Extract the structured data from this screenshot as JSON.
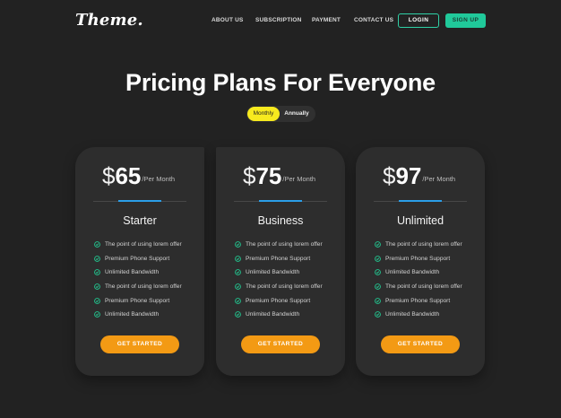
{
  "brand": {
    "logo_text": "Theme."
  },
  "nav": {
    "links": [
      "ABOUT US",
      "SUBSCRIPTION",
      "PAYMENT",
      "CONTACT US"
    ],
    "login_label": "LOGIN",
    "signup_label": "SIGN UP"
  },
  "hero": {
    "title": "Pricing Plans For Everyone",
    "toggle": {
      "options": [
        "Monthly",
        "Annually"
      ],
      "selected": "Monthly"
    }
  },
  "colors": {
    "background": "#222222",
    "card": "#2d2d2d",
    "accent_green": "#20c99a",
    "accent_yellow": "#f7ea1e",
    "accent_orange": "#f39a14",
    "accent_blue": "#2b9ee8"
  },
  "plans": [
    {
      "currency": "$",
      "amount": "65",
      "period": "/Per Month",
      "name": "Starter",
      "features": [
        "The point of using lorem offer",
        "Premium Phone Support",
        "Unlimited Bandwidth",
        "The point of using lorem offer",
        "Premium Phone Support",
        "Unlimited Bandwidth"
      ],
      "cta": "GET STARTED"
    },
    {
      "currency": "$",
      "amount": "75",
      "period": "/Per Month",
      "name": "Business",
      "features": [
        "The point of using lorem offer",
        "Premium Phone Support",
        "Unlimited Bandwidth",
        "The point of using lorem offer",
        "Premium Phone Support",
        "Unlimited Bandwidth"
      ],
      "cta": "GET STARTED"
    },
    {
      "currency": "$",
      "amount": "97",
      "period": "/Per Month",
      "name": "Unlimited",
      "features": [
        "The point of using lorem offer",
        "Premium Phone Support",
        "Unlimited Bandwidth",
        "The point of using lorem offer",
        "Premium Phone Support",
        "Unlimited Bandwidth"
      ],
      "cta": "GET STARTED"
    }
  ],
  "icons": {
    "feature_check": "check-circle-icon"
  }
}
